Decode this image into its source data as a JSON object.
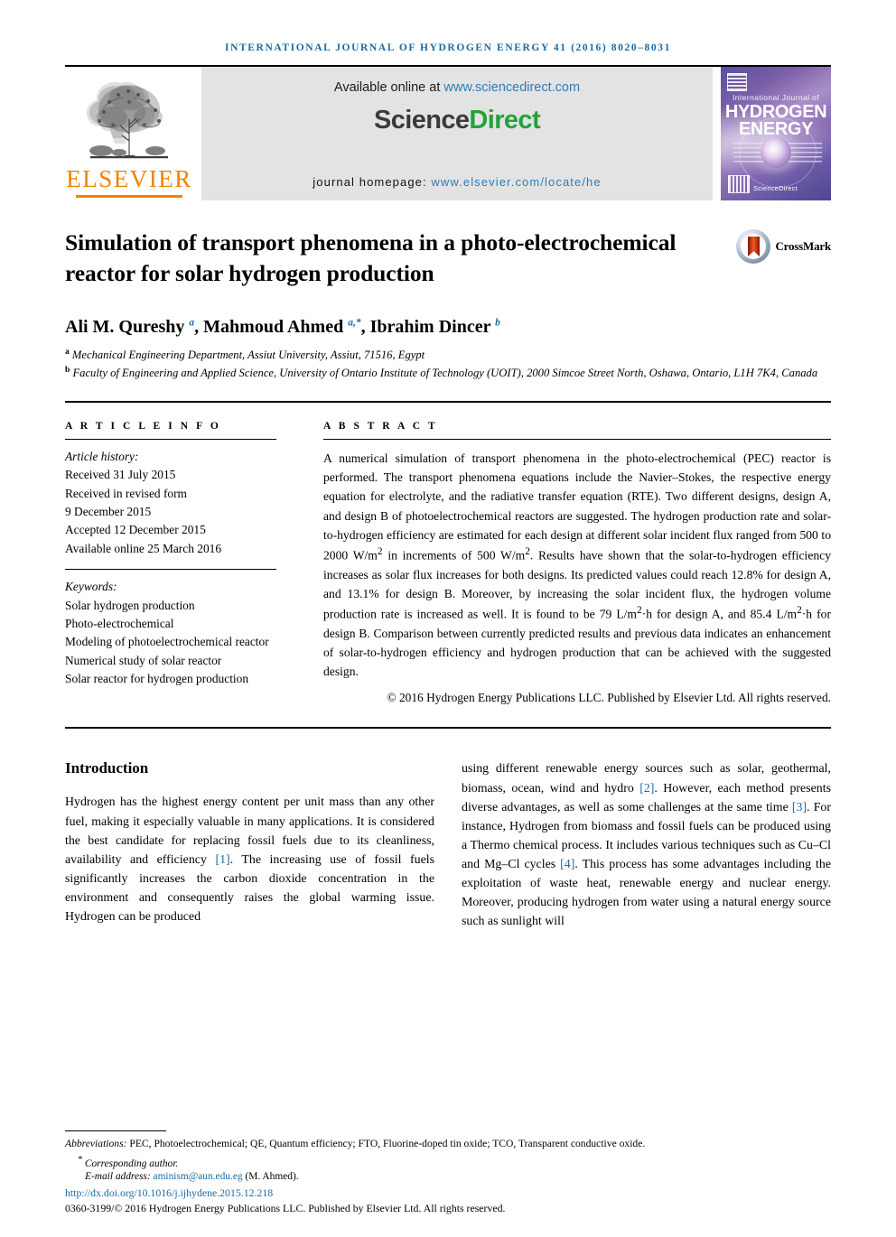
{
  "running_head": "INTERNATIONAL JOURNAL OF HYDROGEN ENERGY 41 (2016) 8020–8031",
  "publisher": {
    "name": "ELSEVIER",
    "logo_icon": "elsevier-tree-icon",
    "brand_color": "#f08300"
  },
  "sciencedirect": {
    "available_prefix": "Available online at ",
    "available_url": "www.sciencedirect.com",
    "logo_part1": "Science",
    "logo_part2": "Direct",
    "homepage_label": "journal homepage: ",
    "homepage_url": "www.elsevier.com/locate/he",
    "link_color": "#2e7db5",
    "green": "#23a23a"
  },
  "cover": {
    "line_small": "International Journal of",
    "line_big1": "HYDROGEN",
    "line_big2": "ENERGY",
    "footer_mark": "ScienceDirect"
  },
  "article": {
    "title": "Simulation of transport phenomena in a photo-electrochemical reactor for solar hydrogen production",
    "crossmark_label": "CrossMark",
    "authors_html": "Ali M. Qureshy <sup>a</sup>, Mahmoud Ahmed <sup>a,*</sup>, Ibrahim Dincer <sup>b</sup>",
    "affiliation_a": "Mechanical Engineering Department, Assiut University, Assiut, 71516, Egypt",
    "affiliation_b": "Faculty of Engineering and Applied Science, University of Ontario Institute of Technology (UOIT), 2000 Simcoe Street North, Oshawa, Ontario, L1H 7K4, Canada"
  },
  "info": {
    "heading": "A R T I C L E   I N F O",
    "history_label": "Article history:",
    "history": [
      "Received 31 July 2015",
      "Received in revised form",
      "9 December 2015",
      "Accepted 12 December 2015",
      "Available online 25 March 2016"
    ],
    "keywords_label": "Keywords:",
    "keywords": [
      "Solar hydrogen production",
      "Photo-electrochemical",
      "Modeling of photoelectrochemical reactor",
      "Numerical study of solar reactor",
      "Solar reactor for hydrogen production"
    ]
  },
  "abstract": {
    "heading": "A B S T R A C T",
    "text_html": "A numerical simulation of transport phenomena in the photo-electrochemical (PEC) reactor is performed. The transport phenomena equations include the Navier–Stokes, the respective energy equation for electrolyte, and the radiative transfer equation (RTE). Two different designs, design A, and design B of photoelectrochemical reactors are suggested. The hydrogen production rate and solar-to-hydrogen efficiency are estimated for each design at different solar incident flux ranged from 500 to 2000 W/m<sup>2</sup> in increments of 500 W/m<sup>2</sup>. Results have shown that the solar-to-hydrogen efficiency increases as solar flux increases for both designs. Its predicted values could reach 12.8% for design A, and 13.1% for design B. Moreover, by increasing the solar incident flux, the hydrogen volume production rate is increased as well. It is found to be 79 L/m<sup>2</sup>·h for design A, and 85.4 L/m<sup>2</sup>·h for design B. Comparison between currently predicted results and previous data indicates an enhancement of solar-to-hydrogen efficiency and hydrogen production that can be achieved with the suggested design.",
    "copyright": "© 2016 Hydrogen Energy Publications LLC. Published by Elsevier Ltd. All rights reserved."
  },
  "body": {
    "section_title": "Introduction",
    "left_paragraph_html": "Hydrogen has the highest energy content per unit mass than any other fuel, making it especially valuable in many applications. It is considered the best candidate for replacing fossil fuels due to its cleanliness, availability and efficiency <span class=\"ref\">[1]</span>. The increasing use of fossil fuels significantly increases the carbon dioxide concentration in the environment and consequently raises the global warming issue. Hydrogen can be produced",
    "right_paragraph_html": "using different renewable energy sources such as solar, geothermal, biomass, ocean, wind and hydro <span class=\"ref\">[2]</span>. However, each method presents diverse advantages, as well as some challenges at the same time <span class=\"ref\">[3]</span>. For instance, Hydrogen from biomass and fossil fuels can be produced using a Thermo chemical process. It includes various techniques such as Cu–Cl and Mg–Cl cycles <span class=\"ref\">[4]</span>. This process has some advantages including the exploitation of waste heat, renewable energy and nuclear energy. Moreover, producing hydrogen from water using a natural energy source such as sunlight will"
  },
  "footnotes": {
    "abbreviations_html": "<span class=\"ital\">Abbreviations:</span> PEC, Photoelectrochemical; QE, Quantum efficiency; FTO, Fluorine-doped tin oxide; TCO, Transparent conductive oxide.",
    "corresponding_author": "Corresponding author.",
    "email_label": "E-mail address: ",
    "email": "aminism@aun.edu.eg",
    "email_suffix": " (M. Ahmed).",
    "doi": "http://dx.doi.org/10.1016/j.ijhydene.2015.12.218",
    "issn_line": "0360-3199/© 2016 Hydrogen Energy Publications LLC. Published by Elsevier Ltd. All rights reserved."
  }
}
